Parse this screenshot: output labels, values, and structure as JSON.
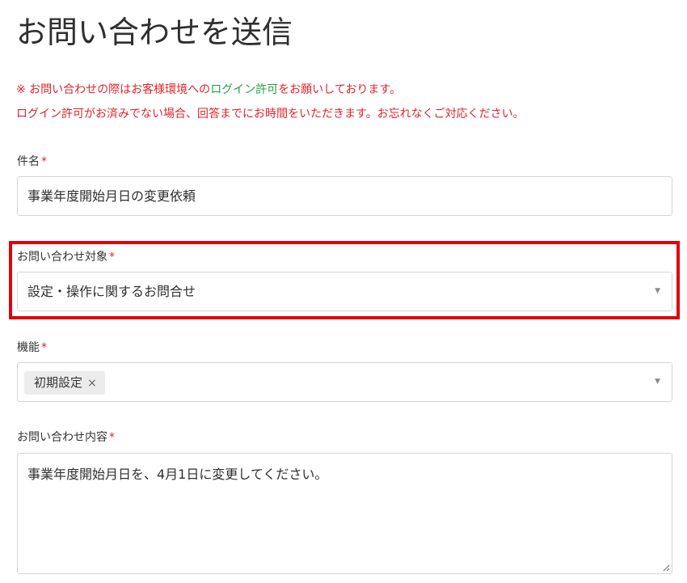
{
  "page": {
    "title": "お問い合わせを送信"
  },
  "notice": {
    "line1_before": "※ お問い合わせの際はお客様環境への",
    "line1_link": "ログイン許可",
    "line1_after": "をお願いしております。",
    "line2": "ログイン許可がお済みでない場合、回答までにお時間をいただきます。お忘れなくご対応ください。"
  },
  "fields": {
    "subject": {
      "label": "件名",
      "required_mark": "*",
      "value": "事業年度開始月日の変更依頼"
    },
    "inquiry_target": {
      "label": "お問い合わせ対象",
      "required_mark": "*",
      "value": "設定・操作に関するお問合せ",
      "arrow": "▼"
    },
    "function": {
      "label": "機能",
      "required_mark": "*",
      "tags": [
        {
          "label": "初期設定",
          "remove": "×"
        }
      ],
      "arrow": "▼"
    },
    "content": {
      "label": "お問い合わせ内容",
      "required_mark": "*",
      "value": "事業年度開始月日を、4月1日に変更してください。"
    }
  },
  "colors": {
    "required": "#e0242b",
    "notice": "#e0242b",
    "link": "#2a9d44",
    "highlight": "#e0000b"
  }
}
